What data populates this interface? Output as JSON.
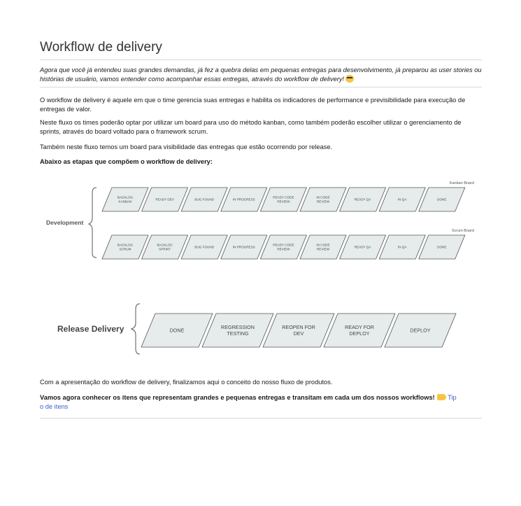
{
  "title": "Workflow de delivery",
  "intro": "Agora que você já entendeu suas grandes demandas, já fez a quebra delas em pequenas entregas para desenvolvimento, já preparou as user stories ou histórias de usuário, vamos entender como acompanhar essas entregas, através do workflow de delivery!",
  "paragraphs": [
    "O workflow de delivery é aquele em que o time gerencia suas entregas e habilita os indicadores de performance e previsibilidade para execução de entregas de valor.",
    "Neste fluxo os times poderão optar por utilizar um board para uso do método kanban, como também poderão escolher utilizar o gerenciamento de sprints, através do board voltado para o framework  scrum.",
    "Também neste fluxo temos um board para visibilidade das entregas que estão ocorrendo por release."
  ],
  "steps_heading": "Abaixo as etapas que compõem o workflow de delivery:",
  "diagram": {
    "development_label": "Development",
    "kanban_label": "Kanban Board",
    "scrum_label": "Scrum Board",
    "kanban_steps": [
      [
        "BACKLOG",
        "KANBAN"
      ],
      [
        "READY DEV"
      ],
      [
        "BUG FOUND"
      ],
      [
        "IN PROGRESS"
      ],
      [
        "READY CODE",
        "REVIEW"
      ],
      [
        "IN CODE",
        "REVIEW"
      ],
      [
        "READY QA"
      ],
      [
        "IN QA"
      ],
      [
        "DONE"
      ]
    ],
    "scrum_steps": [
      [
        "BACKLOG",
        "SCRUM"
      ],
      [
        "BACKLOG",
        "SPRINT"
      ],
      [
        "BUG FOUND"
      ],
      [
        "IN PROGRESS"
      ],
      [
        "READY CODE",
        "REVIEW"
      ],
      [
        "IN CODE",
        "REVIEW"
      ],
      [
        "READY QA"
      ],
      [
        "IN QA"
      ],
      [
        "DONE"
      ]
    ],
    "release_label": "Release Delivery",
    "release_steps": [
      [
        "DONE"
      ],
      [
        "REGRESSION",
        "TESTING"
      ],
      [
        "REOPEN FOR",
        "DEV"
      ],
      [
        "READY FOR",
        "DEPLOY"
      ],
      [
        "DEPLOY"
      ]
    ]
  },
  "closing": "Com a apresentação do workflow de delivery, finalizamos aqui o conceito do nosso fluxo de produtos.",
  "next_text": "Vamos agora conhecer os itens que representam grandes e pequenas entregas e transitam em cada um dos nossos workflows!",
  "next_link_part1": "Tip",
  "next_link_part2": "o de itens",
  "colors": {
    "step_fill": "#e6eceb",
    "step_stroke": "#555555",
    "link": "#3b5bcc"
  }
}
